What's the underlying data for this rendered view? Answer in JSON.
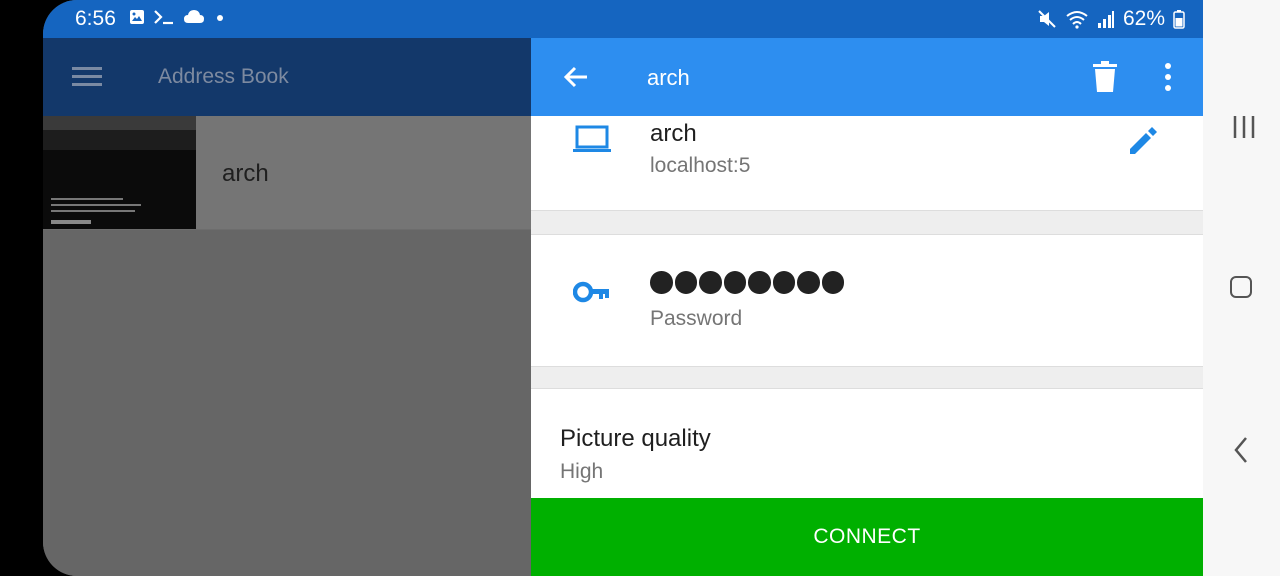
{
  "status_bar": {
    "time": "6:56",
    "battery": "62%"
  },
  "left_app": {
    "title": "Address Book",
    "items": [
      {
        "name": "arch"
      }
    ]
  },
  "detail": {
    "title": "arch",
    "host": {
      "name": "arch",
      "address": "localhost:5"
    },
    "password": {
      "dots": 8,
      "label": "Password"
    },
    "picture_quality": {
      "title": "Picture quality",
      "value": "High"
    },
    "connect_label": "CONNECT"
  },
  "colors": {
    "status_bar": "#1565c0",
    "app_bar": "#2d8ef0",
    "connect": "#00b000",
    "icon_blue": "#1e88e5"
  },
  "icons": [
    "image-icon",
    "terminal-icon",
    "cloud-icon",
    "mute-icon",
    "wifi-icon",
    "signal-icon",
    "battery-icon",
    "menu-icon",
    "back-arrow-icon",
    "delete-icon",
    "more-vert-icon",
    "laptop-icon",
    "edit-icon",
    "key-icon",
    "recent-apps-icon",
    "home-icon",
    "nav-back-icon"
  ]
}
